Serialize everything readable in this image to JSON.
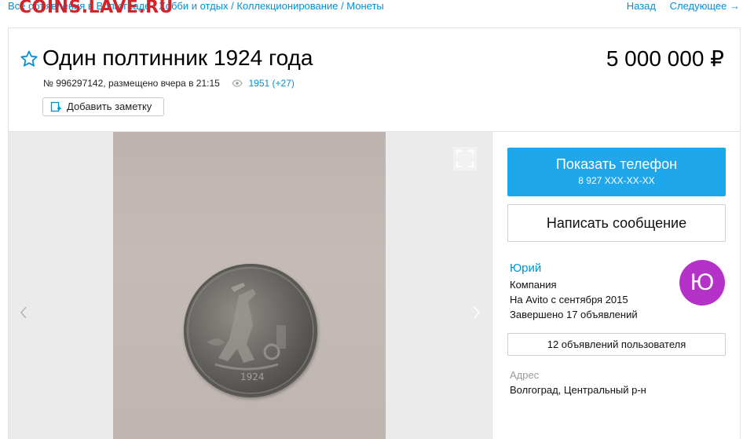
{
  "breadcrumb": {
    "items": [
      "Все объявления в Волгограде",
      "Хобби и отдых",
      "Коллекционирование",
      "Монеты"
    ]
  },
  "watermark": "COINS.LAVE.RU",
  "nav": {
    "back": "Назад",
    "next": "Следующее →"
  },
  "listing": {
    "title": "Один полтинник 1924 года",
    "price": "5 000 000 ₽",
    "meta": "№ 996297142, размещено вчера в 21:15",
    "views": "1951 (+27)",
    "note_label": "Добавить заметку"
  },
  "photo": {
    "year_on_coin": "1924"
  },
  "contact": {
    "show_phone": "Показать телефон",
    "phone_masked": "8 927 XXX-XX-XX",
    "write_message": "Написать сообщение"
  },
  "seller": {
    "name": "Юрий",
    "type": "Компания",
    "since": "На Avito с сентября 2015",
    "completed": "Завершено 17 объявлений",
    "avatar_letter": "Ю",
    "all_ads": "12 объявлений пользователя"
  },
  "address": {
    "label": "Адрес",
    "value": "Волгоград, Центральный р-н"
  },
  "colors": {
    "link": "#0091d9",
    "phone_button": "#1fa7ec",
    "avatar": "#b532c9",
    "watermark": "#d2232a"
  }
}
